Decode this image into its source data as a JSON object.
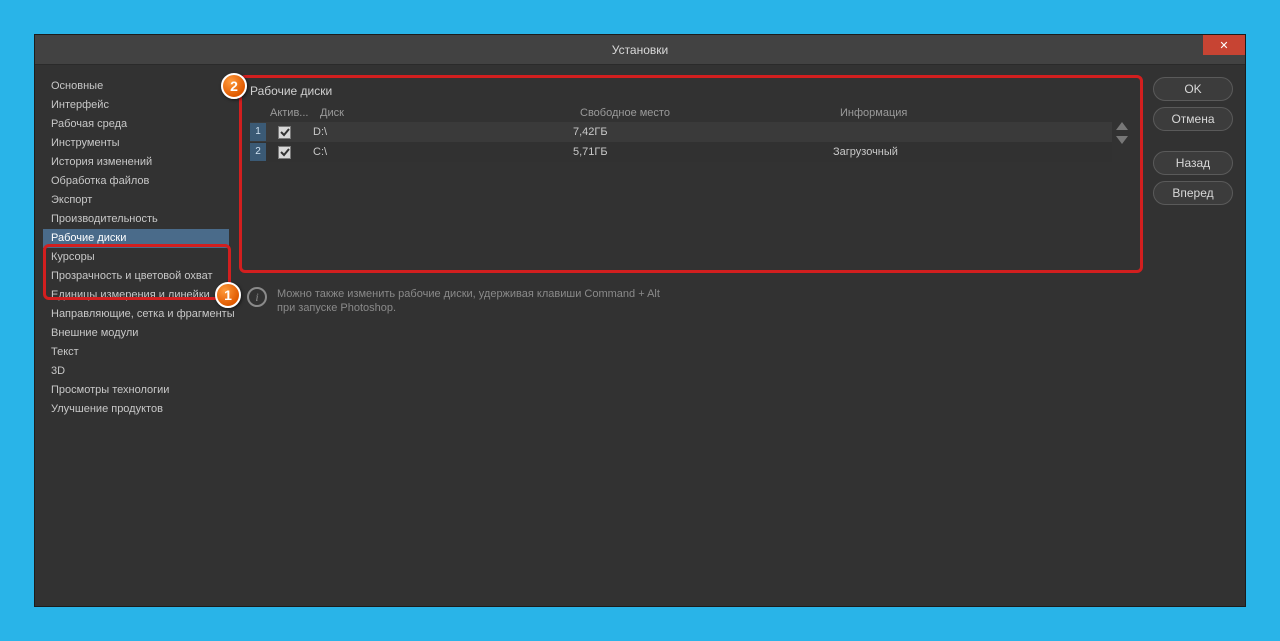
{
  "window": {
    "title": "Установки",
    "close_glyph": "✕"
  },
  "sidebar": {
    "items": [
      {
        "label": "Основные"
      },
      {
        "label": "Интерфейс"
      },
      {
        "label": "Рабочая среда"
      },
      {
        "label": "Инструменты"
      },
      {
        "label": "История изменений"
      },
      {
        "label": "Обработка файлов"
      },
      {
        "label": "Экспорт"
      },
      {
        "label": "Производительность"
      },
      {
        "label": "Рабочие диски",
        "selected": true
      },
      {
        "label": "Курсоры"
      },
      {
        "label": "Прозрачность и цветовой охват"
      },
      {
        "label": "Единицы измерения и линейки"
      },
      {
        "label": "Направляющие, сетка и фрагменты"
      },
      {
        "label": "Внешние модули"
      },
      {
        "label": "Текст"
      },
      {
        "label": "3D"
      },
      {
        "label": "Просмотры технологии"
      },
      {
        "label": "Улучшение продуктов"
      }
    ]
  },
  "panel": {
    "title": "Рабочие диски",
    "headers": {
      "active": "Актив...",
      "disk": "Диск",
      "free": "Свободное место",
      "info": "Информация"
    },
    "rows": [
      {
        "num": "1",
        "active": true,
        "disk": "D:\\",
        "free": "7,42ГБ",
        "info": ""
      },
      {
        "num": "2",
        "active": true,
        "disk": "C:\\",
        "free": "5,71ГБ",
        "info": "Загрузочный"
      }
    ]
  },
  "hint": {
    "line1": "Можно также изменить рабочие диски, удерживая клавиши Command + Alt",
    "line2": "при запуске Photoshop."
  },
  "buttons": {
    "ok": "OK",
    "cancel": "Отмена",
    "back": "Назад",
    "forward": "Вперед"
  },
  "markers": {
    "one": "1",
    "two": "2"
  }
}
